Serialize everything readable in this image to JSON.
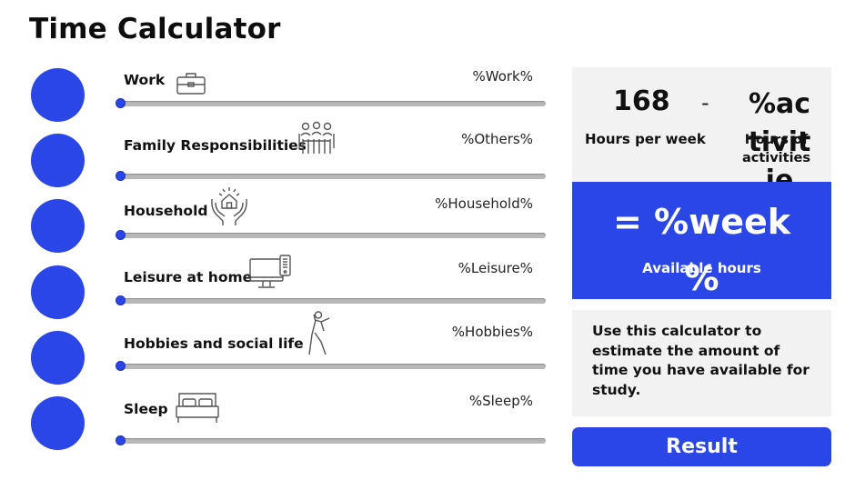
{
  "title": "Time Calculator",
  "accent_color": "#2b46e6",
  "activities": [
    {
      "label": "Work",
      "variable": "%Work%",
      "icon": "briefcase-icon",
      "value": 0
    },
    {
      "label": "Family Responsibilities",
      "variable": "%Others%",
      "icon": "family-icon",
      "value": 0
    },
    {
      "label": "Household",
      "variable": "%Household%",
      "icon": "house-in-hands-icon",
      "value": 0
    },
    {
      "label": "Leisure at home",
      "variable": "%Leisure%",
      "icon": "computer-icon",
      "value": 0
    },
    {
      "label": "Hobbies and social life",
      "variable": "%Hobbies%",
      "icon": "walking-person-icon",
      "value": 0
    },
    {
      "label": "Sleep",
      "variable": "%Sleep%",
      "icon": "bed-icon",
      "value": 0
    }
  ],
  "summary": {
    "hours_per_week_value": "168",
    "hours_per_week_label": "Hours per week",
    "minus": "-",
    "activities_value": "%activities%",
    "activities_label": "Hours of activities",
    "week_value": "= %week",
    "week_value_cont": "%",
    "available_label": "Available hours"
  },
  "info_text": "Use this calculator to estimate the amount of time you have available for study.",
  "result_button": "Result"
}
